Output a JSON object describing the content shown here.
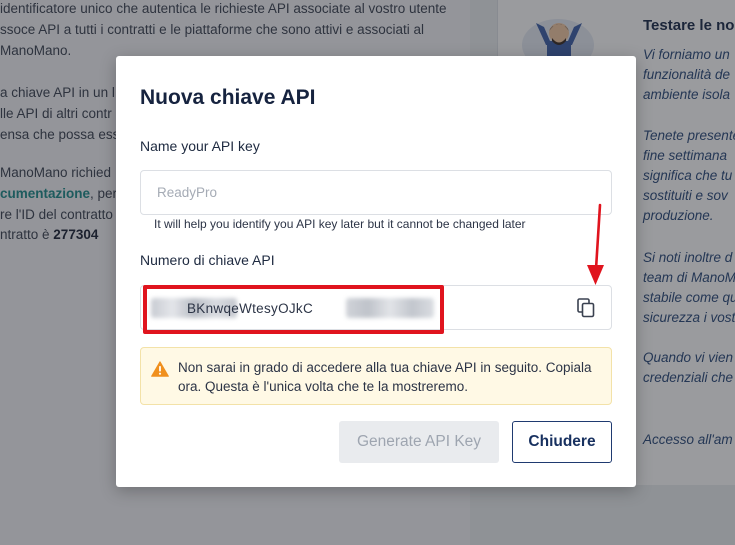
{
  "background": {
    "lines": [
      " identificatore unico che autentica le richieste API associate al vostro utente",
      "ssoce API a tutti i contratti e le piattaforme che sono attivi e associati al",
      "ManoMano.",
      "a chiave API in un l",
      "lle API di altri contr",
      "ensa che possa ess",
      "ManoMano richied",
      "re l'ID del contratto",
      "ntratto è "
    ],
    "doc_link": "cumentazione",
    "doc_suffix": ", per",
    "contract_id": "277304",
    "right_panel": {
      "title": "Testare le nos",
      "lines": [
        "Vi forniamo un",
        "funzionalità de",
        "ambiente isola",
        "Tenete presente",
        "fine settimana",
        "significa che tu",
        "sostituiti e sov",
        "produzione.",
        "Si noti inoltre d",
        "team di ManoM",
        "stabile come qu",
        "sicurezza i vost",
        "Quando vi vien",
        "credenziali che",
        "Accesso all'am"
      ]
    }
  },
  "modal": {
    "title": "Nuova chiave API",
    "name_label": "Name your API key",
    "name_placeholder": "ReadyPro",
    "name_hint": "It will help you identify you API key later but it cannot be changed later",
    "key_label": "Numero di chiave API",
    "key_visible": "BKnwqeWtesyOJkC",
    "warning": "Non sarai in grado di accedere alla tua chiave API in seguito. Copiala ora. Questa è l'unica volta che te la mostreremo.",
    "generate_label": "Generate API Key",
    "close_label": "Chiudere",
    "icons": [
      "copy-icon",
      "warning-icon"
    ]
  },
  "colors": {
    "accent": "#1f3a70",
    "warning_bg": "#fff9e5",
    "warning_icon": "#f0901e",
    "annotation_red": "#e0141e",
    "link": "#1d8a8a"
  }
}
